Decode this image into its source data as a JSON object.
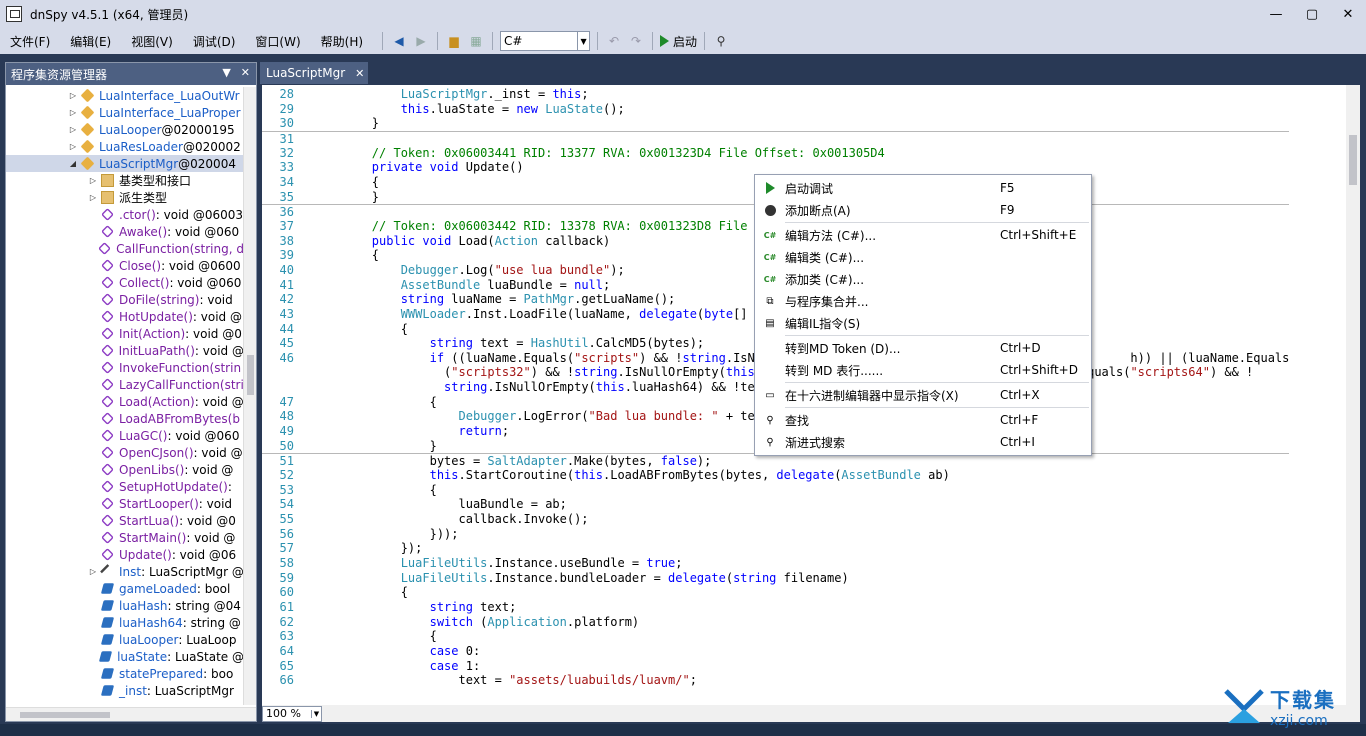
{
  "window": {
    "title": "dnSpy v4.5.1 (x64, 管理员)",
    "controls": [
      "—",
      "▢",
      "✕"
    ]
  },
  "menu": [
    "文件(F)",
    "编辑(E)",
    "视图(V)",
    "调试(D)",
    "窗口(W)",
    "帮助(H)"
  ],
  "toolbar": {
    "language": "C#",
    "start_label": "启动"
  },
  "explorer": {
    "title": "程序集资源管理器",
    "rows": [
      {
        "arrow": "▷",
        "icon": "cls",
        "name": "LuaInterface_LuaOutWr",
        "rest": ""
      },
      {
        "arrow": "▷",
        "icon": "cls",
        "name": "LuaInterface_LuaProper",
        "rest": ""
      },
      {
        "arrow": "▷",
        "icon": "cls",
        "name": "LuaLooper",
        "rest": " @02000195"
      },
      {
        "arrow": "▷",
        "icon": "cls",
        "name": "LuaResLoader",
        "rest": " @020002"
      },
      {
        "arrow": "◢",
        "icon": "cls",
        "name": "LuaScriptMgr",
        "rest": " @020004",
        "sel": true
      },
      {
        "arrow": "▷",
        "icon": "fold",
        "name": "基类型和接口",
        "rest": "",
        "plain": true,
        "indent": 1
      },
      {
        "arrow": "▷",
        "icon": "fold",
        "name": "派生类型",
        "rest": "",
        "plain": true,
        "indent": 1
      },
      {
        "arrow": "",
        "icon": "meth",
        "name": ".ctor()",
        "rest": " : void @06003",
        "indent": 1
      },
      {
        "arrow": "",
        "icon": "meth",
        "name": "Awake()",
        "rest": " : void @060",
        "indent": 1
      },
      {
        "arrow": "",
        "icon": "meth",
        "name": "CallFunction(string, d",
        "rest": "",
        "indent": 1
      },
      {
        "arrow": "",
        "icon": "meth",
        "name": "Close()",
        "rest": " : void @0600",
        "indent": 1
      },
      {
        "arrow": "",
        "icon": "meth",
        "name": "Collect()",
        "rest": " : void @060",
        "indent": 1
      },
      {
        "arrow": "",
        "icon": "meth",
        "name": "DoFile(string)",
        "rest": " : void",
        "indent": 1
      },
      {
        "arrow": "",
        "icon": "meth",
        "name": "HotUpdate()",
        "rest": " : void @",
        "indent": 1
      },
      {
        "arrow": "",
        "icon": "meth",
        "name": "Init(Action)",
        "rest": " : void @0",
        "indent": 1
      },
      {
        "arrow": "",
        "icon": "meth",
        "name": "InitLuaPath()",
        "rest": " : void @",
        "indent": 1
      },
      {
        "arrow": "",
        "icon": "meth",
        "name": "InvokeFunction(strin",
        "rest": "",
        "indent": 1
      },
      {
        "arrow": "",
        "icon": "meth",
        "name": "LazyCallFunction(stri",
        "rest": "",
        "indent": 1
      },
      {
        "arrow": "",
        "icon": "meth",
        "name": "Load(Action)",
        "rest": " : void @",
        "indent": 1
      },
      {
        "arrow": "",
        "icon": "meth",
        "name": "LoadABFromBytes(b",
        "rest": "",
        "indent": 1
      },
      {
        "arrow": "",
        "icon": "meth",
        "name": "LuaGC()",
        "rest": " : void @060",
        "indent": 1
      },
      {
        "arrow": "",
        "icon": "meth",
        "name": "OpenCJson()",
        "rest": " : void @",
        "indent": 1
      },
      {
        "arrow": "",
        "icon": "meth",
        "name": "OpenLibs()",
        "rest": " : void @",
        "indent": 1
      },
      {
        "arrow": "",
        "icon": "meth",
        "name": "SetupHotUpdate()",
        "rest": " :",
        "indent": 1
      },
      {
        "arrow": "",
        "icon": "meth",
        "name": "StartLooper()",
        "rest": " : void",
        "indent": 1
      },
      {
        "arrow": "",
        "icon": "meth",
        "name": "StartLua()",
        "rest": " : void @0",
        "indent": 1
      },
      {
        "arrow": "",
        "icon": "meth",
        "name": "StartMain()",
        "rest": " : void @",
        "indent": 1
      },
      {
        "arrow": "",
        "icon": "meth",
        "name": "Update()",
        "rest": " : void @06",
        "indent": 1
      },
      {
        "arrow": "▷",
        "icon": "prop",
        "name": "Inst",
        "rest": " : LuaScriptMgr @",
        "indent": 1
      },
      {
        "arrow": "",
        "icon": "fld",
        "name": "gameLoaded",
        "rest": " : bool",
        "indent": 1
      },
      {
        "arrow": "",
        "icon": "fld",
        "name": "luaHash",
        "rest": " : string @04",
        "indent": 1
      },
      {
        "arrow": "",
        "icon": "fld",
        "name": "luaHash64",
        "rest": " : string @",
        "indent": 1
      },
      {
        "arrow": "",
        "icon": "fld",
        "name": "luaLooper",
        "rest": " : LuaLoop",
        "indent": 1
      },
      {
        "arrow": "",
        "icon": "fld",
        "name": "luaState",
        "rest": " : LuaState @",
        "indent": 1
      },
      {
        "arrow": "",
        "icon": "fld",
        "name": "statePrepared",
        "rest": " : boo",
        "indent": 1
      },
      {
        "arrow": "",
        "icon": "fld",
        "name": "_inst",
        "rest": " : LuaScriptMgr",
        "indent": 1
      }
    ]
  },
  "tab": {
    "label": "LuaScriptMgr"
  },
  "code": [
    {
      "n": "28",
      "t": "            LuaScriptMgr._inst = this;"
    },
    {
      "n": "29",
      "t": "            this.luaState = new LuaState();"
    },
    {
      "n": "30",
      "t": "        }"
    },
    {
      "n": "31",
      "t": "",
      "sep": true
    },
    {
      "n": "32",
      "t": "        // Token: 0x06003441 RID: 13377 RVA: 0x001323D4 File Offset: 0x001305D4",
      "c": "cc"
    },
    {
      "n": "33",
      "t": "        private void Update()"
    },
    {
      "n": "34",
      "t": "        {"
    },
    {
      "n": "35",
      "t": "        }"
    },
    {
      "n": "36",
      "t": "",
      "sep": true
    },
    {
      "n": "37",
      "t": "        // Token: 0x06003442 RID: 13378 RVA: 0x001323D8 File Off",
      "c": "cc"
    },
    {
      "n": "38",
      "t": "        public void Load(Action callback)"
    },
    {
      "n": "39",
      "t": "        {"
    },
    {
      "n": "40",
      "t": "            Debugger.Log(\"use lua bundle\");"
    },
    {
      "n": "41",
      "t": "            AssetBundle luaBundle = null;"
    },
    {
      "n": "42",
      "t": "            string luaName = PathMgr.getLuaName();"
    },
    {
      "n": "43",
      "t": "            WWWLoader.Inst.LoadFile(luaName, delegate(byte[] byt"
    },
    {
      "n": "44",
      "t": "            {"
    },
    {
      "n": "45",
      "t": "                string text = HashUtil.CalcMD5(bytes);"
    },
    {
      "n": "46",
      "t": "                if ((luaName.Equals(\"scripts\") && !string.IsNull                                                 h)) || (luaName.Equals"
    },
    {
      "n": "",
      "t": "                  (\"scripts32\") && !string.IsNullOrEmpty(this.lu                                        e.Equals(\"scripts64\") && !"
    },
    {
      "n": "",
      "t": "                  string.IsNullOrEmpty(this.luaHash64) && !text."
    },
    {
      "n": "47",
      "t": "                {"
    },
    {
      "n": "48",
      "t": "                    Debugger.LogError(\"Bad lua bundle: \" + text)"
    },
    {
      "n": "49",
      "t": "                    return;"
    },
    {
      "n": "50",
      "t": "                }"
    },
    {
      "n": "51",
      "t": "                bytes = SaltAdapter.Make(bytes, false);",
      "sep": true
    },
    {
      "n": "52",
      "t": "                this.StartCoroutine(this.LoadABFromBytes(bytes, delegate(AssetBundle ab)"
    },
    {
      "n": "53",
      "t": "                {"
    },
    {
      "n": "54",
      "t": "                    luaBundle = ab;"
    },
    {
      "n": "55",
      "t": "                    callback.Invoke();"
    },
    {
      "n": "56",
      "t": "                }));"
    },
    {
      "n": "57",
      "t": "            });"
    },
    {
      "n": "58",
      "t": "            LuaFileUtils.Instance.useBundle = true;"
    },
    {
      "n": "59",
      "t": "            LuaFileUtils.Instance.bundleLoader = delegate(string filename)"
    },
    {
      "n": "60",
      "t": "            {"
    },
    {
      "n": "61",
      "t": "                string text;"
    },
    {
      "n": "62",
      "t": "                switch (Application.platform)"
    },
    {
      "n": "63",
      "t": "                {"
    },
    {
      "n": "64",
      "t": "                case 0:"
    },
    {
      "n": "65",
      "t": "                case 1:"
    },
    {
      "n": "66",
      "t": "                    text = \"assets/luabuilds/luavm/\";"
    }
  ],
  "zoom": "100 %",
  "context_menu": [
    {
      "icon": "play",
      "label": "启动调试",
      "key": "F5"
    },
    {
      "icon": "dot",
      "label": "添加断点(A)",
      "key": "F9"
    },
    {
      "sep": true
    },
    {
      "icon": "cs",
      "label": "编辑方法 (C#)...",
      "key": "Ctrl+Shift+E"
    },
    {
      "icon": "cs",
      "label": "编辑类 (C#)...",
      "key": ""
    },
    {
      "icon": "cs",
      "label": "添加类 (C#)...",
      "key": ""
    },
    {
      "icon": "merge",
      "label": "与程序集合并...",
      "key": ""
    },
    {
      "icon": "il",
      "label": "编辑IL指令(S)",
      "key": ""
    },
    {
      "sep": true
    },
    {
      "icon": "",
      "label": "转到MD Token (D)...",
      "key": "Ctrl+D"
    },
    {
      "icon": "",
      "label": "转到 MD 表行......",
      "key": "Ctrl+Shift+D"
    },
    {
      "sep": true
    },
    {
      "icon": "hex",
      "label": "在十六进制编辑器中显示指令(X)",
      "key": "Ctrl+X"
    },
    {
      "sep": true
    },
    {
      "icon": "search",
      "label": "查找",
      "key": "Ctrl+F"
    },
    {
      "icon": "search",
      "label": "渐进式搜索",
      "key": "Ctrl+I"
    }
  ],
  "watermark": {
    "cn": "下载集",
    "url": "xzji.com"
  }
}
